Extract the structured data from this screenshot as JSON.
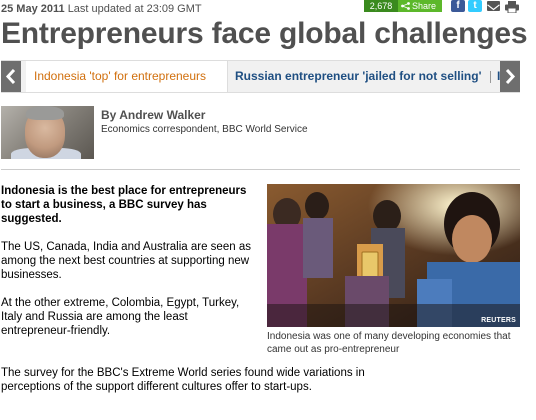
{
  "meta": {
    "date": "25 May 2011",
    "updated": "Last updated at 23:09 GMT",
    "share_count": "2,678",
    "share_label": "Share",
    "icons": [
      "facebook-icon",
      "twitter-icon",
      "email-icon",
      "print-icon"
    ]
  },
  "headline": "Entrepreneurs face global challenges",
  "strip": {
    "items": [
      "Indonesia 'top' for entrepreneurs",
      "Russian entrepreneur 'jailed for not selling'",
      "In"
    ]
  },
  "byline": {
    "author": "By Andrew Walker",
    "role": "Economics correspondent, BBC World Service"
  },
  "body": {
    "intro": "Indonesia is the best place for entrepreneurs to start a business, a BBC survey has suggested.",
    "p1": "The US, Canada, India and Australia are seen as among the next best countries at supporting new businesses.",
    "p2": "At the other extreme, Colombia, Egypt, Turkey, Italy and Russia are among the least entrepreneur-friendly.",
    "p3": "The survey for the BBC's Extreme World series found wide variations in perceptions of the support different cultures offer to start-ups."
  },
  "image": {
    "credit": "REUTERS",
    "caption": "Indonesia was one of many developing economies that came out as pro-entrepreneur"
  },
  "colors": {
    "headline": "#505050",
    "tab_active": "#d1700e",
    "link": "#1f4f82",
    "share_green": "#5cb82a"
  }
}
